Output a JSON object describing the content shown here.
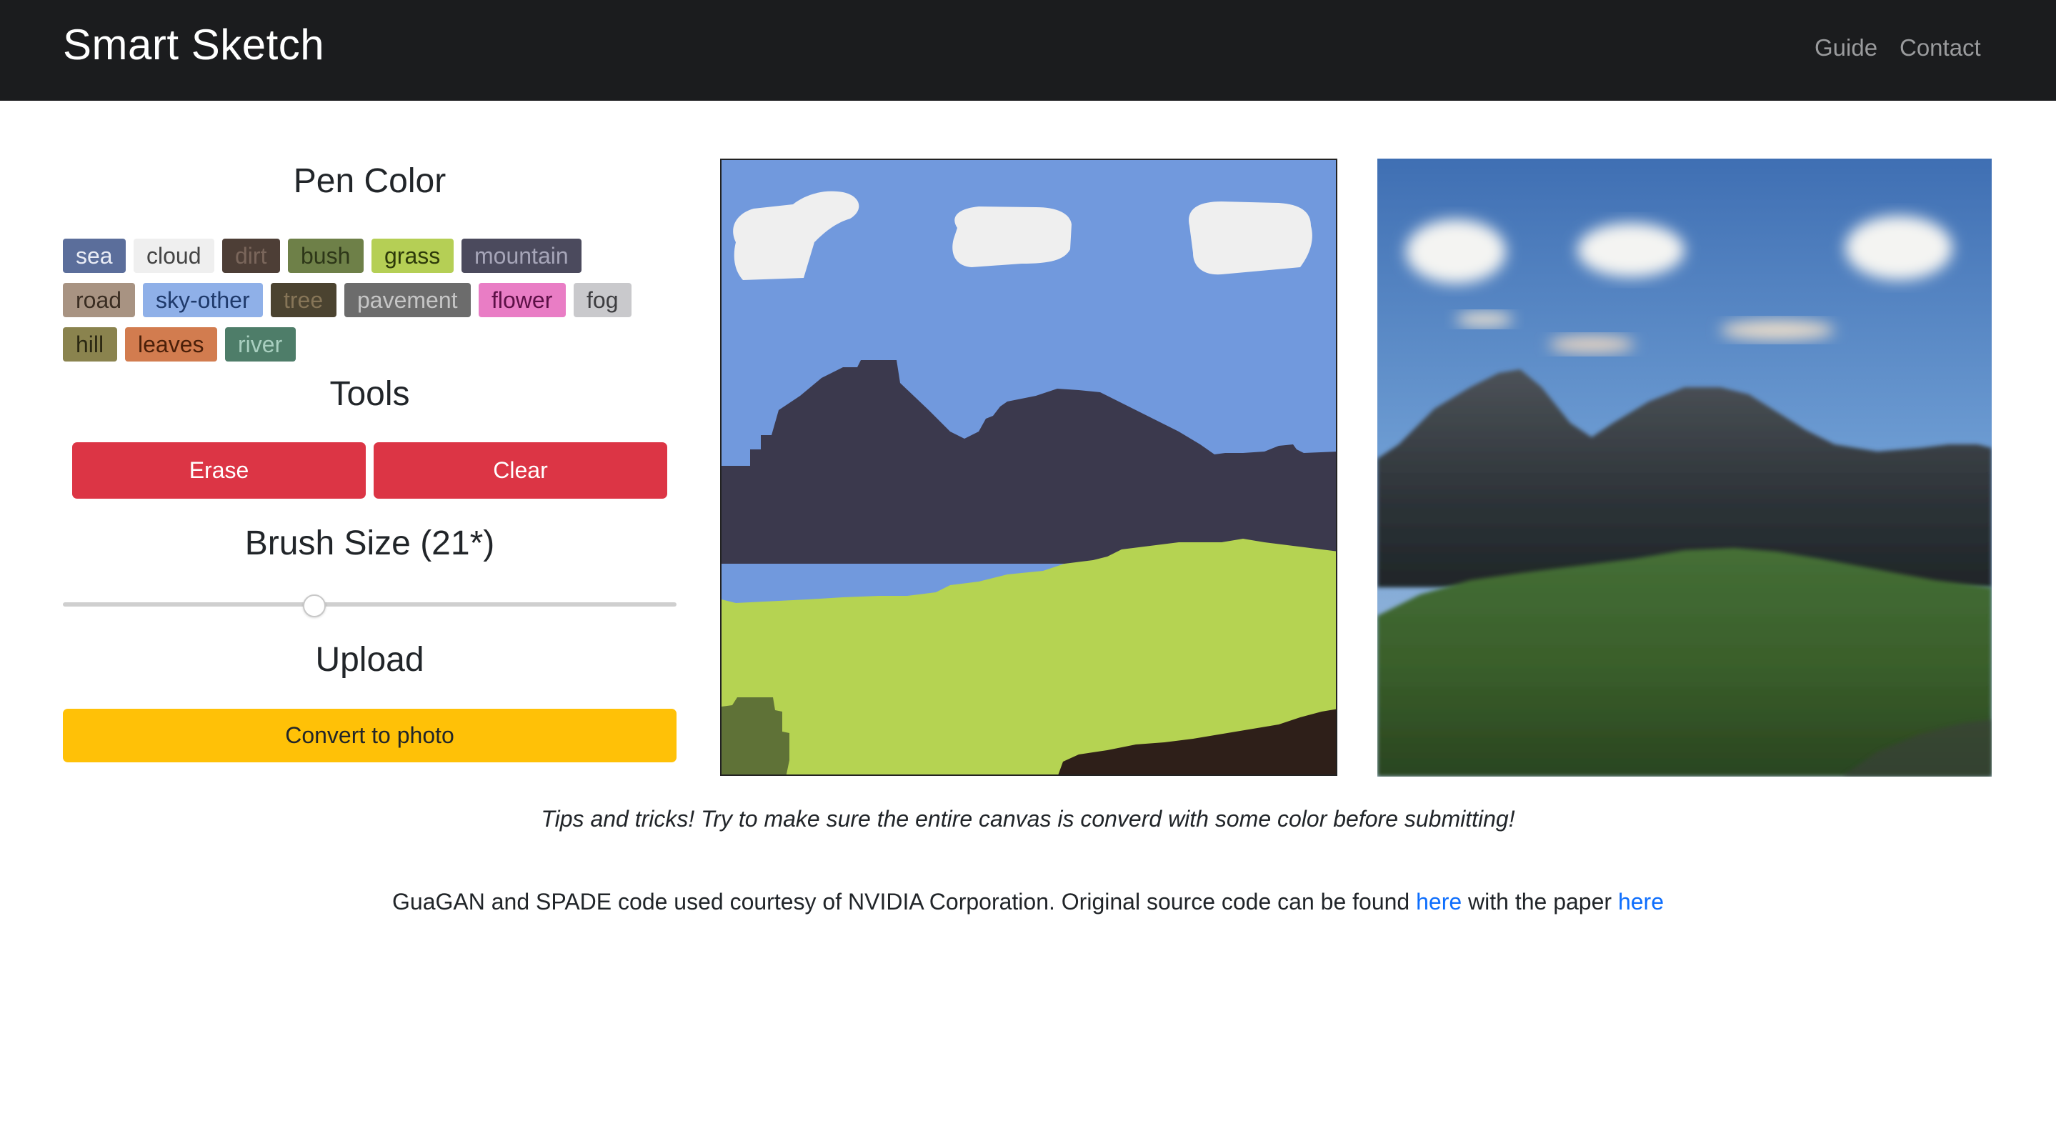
{
  "nav": {
    "brand": "Smart Sketch",
    "links": [
      "Guide",
      "Contact"
    ]
  },
  "pen": {
    "title": "Pen Color",
    "colors": [
      {
        "label": "sea",
        "bg": "#5b6e9b",
        "fg": "#e9ecf5"
      },
      {
        "label": "cloud",
        "bg": "#efefef",
        "fg": "#444444"
      },
      {
        "label": "dirt",
        "bg": "#4d3e36",
        "fg": "#7a665b"
      },
      {
        "label": "bush",
        "bg": "#6e8048",
        "fg": "#2d3618"
      },
      {
        "label": "grass",
        "bg": "#b5cf55",
        "fg": "#2d3a0a"
      },
      {
        "label": "mountain",
        "bg": "#4b4a5d",
        "fg": "#a6a5b8"
      },
      {
        "label": "road",
        "bg": "#a89382",
        "fg": "#3a2d22"
      },
      {
        "label": "sky-other",
        "bg": "#8fb0e8",
        "fg": "#1f3a6b"
      },
      {
        "label": "tree",
        "bg": "#4b4330",
        "fg": "#867557"
      },
      {
        "label": "pavement",
        "bg": "#6c6c6c",
        "fg": "#c6c6c6"
      },
      {
        "label": "flower",
        "bg": "#e97dc5",
        "fg": "#5c1046"
      },
      {
        "label": "fog",
        "bg": "#c9c9cc",
        "fg": "#3d3d40"
      },
      {
        "label": "hill",
        "bg": "#8a834e",
        "fg": "#2b2812"
      },
      {
        "label": "leaves",
        "bg": "#d27c4f",
        "fg": "#4a1f09"
      },
      {
        "label": "river",
        "bg": "#4e7d69",
        "fg": "#a9cfc0"
      }
    ]
  },
  "tools": {
    "title": "Tools",
    "erase_label": "Erase",
    "clear_label": "Clear"
  },
  "brush": {
    "title": "Brush Size (21*)",
    "value": 21,
    "fraction": 0.41
  },
  "upload": {
    "title": "Upload",
    "convert_label": "Convert to photo"
  },
  "tips": "Tips and tricks! Try to make sure the entire canvas is converd with some color before submitting!",
  "credits": {
    "text": "GuaGAN and SPADE code used courtesy of NVIDIA Corporation. Original source code can be found",
    "link1": "here",
    "middle": "with the paper",
    "link2": "here"
  },
  "colors": {
    "navbar": "#1b1c1e",
    "danger": "#dc3545",
    "warning": "#ffc107",
    "link": "#0d6efd",
    "sketch_sky": "#7199dd",
    "sketch_mountain": "#3b394d",
    "sketch_grass": "#b5d352",
    "sketch_cloud": "#efefef",
    "sketch_dirt": "#2e1f19",
    "sketch_bush": "#5f7237"
  }
}
